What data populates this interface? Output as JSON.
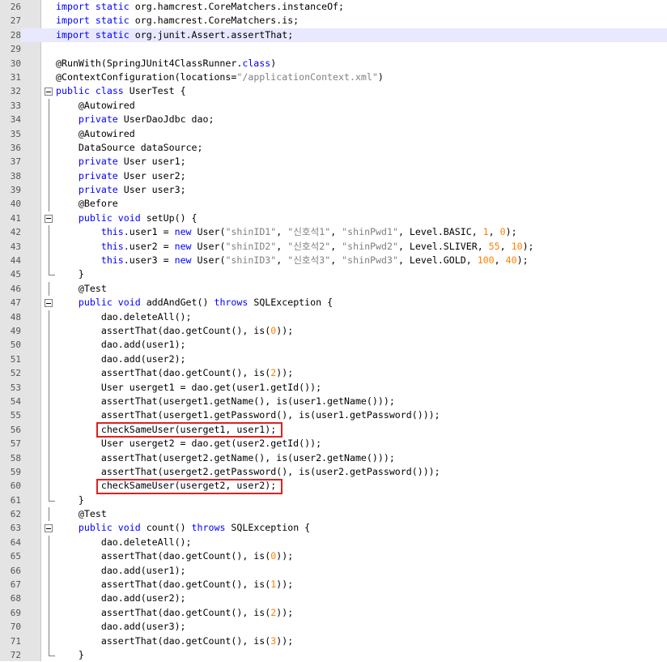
{
  "editor": {
    "current_line": 28,
    "highlighted_lines": [
      56,
      60
    ],
    "lines": [
      {
        "no": "26",
        "fold": "none",
        "tokens": [
          [
            "kw",
            "import"
          ],
          [
            "plain",
            " "
          ],
          [
            "kw",
            "static"
          ],
          [
            "plain",
            " org.hamcrest.CoreMatchers.instanceOf;"
          ]
        ]
      },
      {
        "no": "27",
        "fold": "none",
        "tokens": [
          [
            "kw",
            "import"
          ],
          [
            "plain",
            " "
          ],
          [
            "kw",
            "static"
          ],
          [
            "plain",
            " org.hamcrest.CoreMatchers.is;"
          ]
        ]
      },
      {
        "no": "28",
        "fold": "none",
        "tokens": [
          [
            "kw",
            "import"
          ],
          [
            "plain",
            " "
          ],
          [
            "kw",
            "static"
          ],
          [
            "plain",
            " org.junit.Assert.assertThat;"
          ]
        ]
      },
      {
        "no": "29",
        "fold": "none",
        "tokens": []
      },
      {
        "no": "30",
        "fold": "none",
        "tokens": [
          [
            "plain",
            "@RunWith(SpringJUnit4ClassRunner."
          ],
          [
            "kw",
            "class"
          ],
          [
            "plain",
            ")"
          ]
        ]
      },
      {
        "no": "31",
        "fold": "none",
        "tokens": [
          [
            "plain",
            "@ContextConfiguration(locations="
          ],
          [
            "str",
            "\"/applicationContext.xml\""
          ],
          [
            "plain",
            ")"
          ]
        ]
      },
      {
        "no": "32",
        "fold": "open",
        "tokens": [
          [
            "kw",
            "public"
          ],
          [
            "plain",
            " "
          ],
          [
            "kw",
            "class"
          ],
          [
            "plain",
            " UserTest {"
          ]
        ]
      },
      {
        "no": "33",
        "fold": "line",
        "tokens": [
          [
            "plain",
            "    @Autowired"
          ]
        ]
      },
      {
        "no": "34",
        "fold": "line",
        "tokens": [
          [
            "plain",
            "    "
          ],
          [
            "kw",
            "private"
          ],
          [
            "plain",
            " UserDaoJdbc dao;"
          ]
        ]
      },
      {
        "no": "35",
        "fold": "line",
        "tokens": [
          [
            "plain",
            "    @Autowired"
          ]
        ]
      },
      {
        "no": "36",
        "fold": "line",
        "tokens": [
          [
            "plain",
            "    DataSource dataSource;"
          ]
        ]
      },
      {
        "no": "37",
        "fold": "line",
        "tokens": [
          [
            "plain",
            "    "
          ],
          [
            "kw",
            "private"
          ],
          [
            "plain",
            " User user1;"
          ]
        ]
      },
      {
        "no": "38",
        "fold": "line",
        "tokens": [
          [
            "plain",
            "    "
          ],
          [
            "kw",
            "private"
          ],
          [
            "plain",
            " User user2;"
          ]
        ]
      },
      {
        "no": "39",
        "fold": "line",
        "tokens": [
          [
            "plain",
            "    "
          ],
          [
            "kw",
            "private"
          ],
          [
            "plain",
            " User user3;"
          ]
        ]
      },
      {
        "no": "40",
        "fold": "line",
        "tokens": [
          [
            "plain",
            "    @Before"
          ]
        ]
      },
      {
        "no": "41",
        "fold": "open",
        "tokens": [
          [
            "plain",
            "    "
          ],
          [
            "kw",
            "public"
          ],
          [
            "plain",
            " "
          ],
          [
            "kw",
            "void"
          ],
          [
            "plain",
            " setUp() {"
          ]
        ]
      },
      {
        "no": "42",
        "fold": "line",
        "tokens": [
          [
            "plain",
            "        "
          ],
          [
            "kw",
            "this"
          ],
          [
            "plain",
            ".user1 = "
          ],
          [
            "kw",
            "new"
          ],
          [
            "plain",
            " User("
          ],
          [
            "str",
            "\"shinID1\""
          ],
          [
            "plain",
            ", "
          ],
          [
            "str",
            "\"신호석1\""
          ],
          [
            "plain",
            ", "
          ],
          [
            "str",
            "\"shinPwd1\""
          ],
          [
            "plain",
            ", Level.BASIC, "
          ],
          [
            "num",
            "1"
          ],
          [
            "plain",
            ", "
          ],
          [
            "num",
            "0"
          ],
          [
            "plain",
            ");"
          ]
        ]
      },
      {
        "no": "43",
        "fold": "line",
        "tokens": [
          [
            "plain",
            "        "
          ],
          [
            "kw",
            "this"
          ],
          [
            "plain",
            ".user2 = "
          ],
          [
            "kw",
            "new"
          ],
          [
            "plain",
            " User("
          ],
          [
            "str",
            "\"shinID2\""
          ],
          [
            "plain",
            ", "
          ],
          [
            "str",
            "\"신호석2\""
          ],
          [
            "plain",
            ", "
          ],
          [
            "str",
            "\"shinPwd2\""
          ],
          [
            "plain",
            ", Level.SLIVER, "
          ],
          [
            "num",
            "55"
          ],
          [
            "plain",
            ", "
          ],
          [
            "num",
            "10"
          ],
          [
            "plain",
            ");"
          ]
        ]
      },
      {
        "no": "44",
        "fold": "line",
        "tokens": [
          [
            "plain",
            "        "
          ],
          [
            "kw",
            "this"
          ],
          [
            "plain",
            ".user3 = "
          ],
          [
            "kw",
            "new"
          ],
          [
            "plain",
            " User("
          ],
          [
            "str",
            "\"shinID3\""
          ],
          [
            "plain",
            ", "
          ],
          [
            "str",
            "\"신호석3\""
          ],
          [
            "plain",
            ", "
          ],
          [
            "str",
            "\"shinPwd3\""
          ],
          [
            "plain",
            ", Level.GOLD, "
          ],
          [
            "num",
            "100"
          ],
          [
            "plain",
            ", "
          ],
          [
            "num",
            "40"
          ],
          [
            "plain",
            ");"
          ]
        ]
      },
      {
        "no": "45",
        "fold": "close",
        "tokens": [
          [
            "plain",
            "    }"
          ]
        ]
      },
      {
        "no": "46",
        "fold": "line",
        "tokens": [
          [
            "plain",
            "    @Test"
          ]
        ]
      },
      {
        "no": "47",
        "fold": "open",
        "tokens": [
          [
            "plain",
            "    "
          ],
          [
            "kw",
            "public"
          ],
          [
            "plain",
            " "
          ],
          [
            "kw",
            "void"
          ],
          [
            "plain",
            " addAndGet() "
          ],
          [
            "kw",
            "throws"
          ],
          [
            "plain",
            " SQLException {"
          ]
        ]
      },
      {
        "no": "48",
        "fold": "line",
        "tokens": [
          [
            "plain",
            "        dao.deleteAll();"
          ]
        ]
      },
      {
        "no": "49",
        "fold": "line",
        "tokens": [
          [
            "plain",
            "        assertThat(dao.getCount(), is("
          ],
          [
            "num",
            "0"
          ],
          [
            "plain",
            "));"
          ]
        ]
      },
      {
        "no": "50",
        "fold": "line",
        "tokens": [
          [
            "plain",
            "        dao.add(user1);"
          ]
        ]
      },
      {
        "no": "51",
        "fold": "line",
        "tokens": [
          [
            "plain",
            "        dao.add(user2);"
          ]
        ]
      },
      {
        "no": "52",
        "fold": "line",
        "tokens": [
          [
            "plain",
            "        assertThat(dao.getCount(), is("
          ],
          [
            "num",
            "2"
          ],
          [
            "plain",
            "));"
          ]
        ]
      },
      {
        "no": "53",
        "fold": "line",
        "tokens": [
          [
            "plain",
            "        User userget1 = dao.get(user1.getId());"
          ]
        ]
      },
      {
        "no": "54",
        "fold": "line",
        "tokens": [
          [
            "plain",
            "        assertThat(userget1.getName(), is(user1.getName()));"
          ]
        ]
      },
      {
        "no": "55",
        "fold": "line",
        "tokens": [
          [
            "plain",
            "        assertThat(userget1.getPassword(), is(user1.getPassword()));"
          ]
        ]
      },
      {
        "no": "56",
        "fold": "line",
        "tokens": [
          [
            "plain",
            "        checkSameUser(userget1, user1);"
          ]
        ]
      },
      {
        "no": "57",
        "fold": "line",
        "tokens": [
          [
            "plain",
            "        User userget2 = dao.get(user2.getId());"
          ]
        ]
      },
      {
        "no": "58",
        "fold": "line",
        "tokens": [
          [
            "plain",
            "        assertThat(userget2.getName(), is(user2.getName()));"
          ]
        ]
      },
      {
        "no": "59",
        "fold": "line",
        "tokens": [
          [
            "plain",
            "        assertThat(userget2.getPassword(), is(user2.getPassword()));"
          ]
        ]
      },
      {
        "no": "60",
        "fold": "line",
        "tokens": [
          [
            "plain",
            "        checkSameUser(userget2, user2);"
          ]
        ]
      },
      {
        "no": "61",
        "fold": "close",
        "tokens": [
          [
            "plain",
            "    }"
          ]
        ]
      },
      {
        "no": "62",
        "fold": "line",
        "tokens": [
          [
            "plain",
            "    @Test"
          ]
        ]
      },
      {
        "no": "63",
        "fold": "open",
        "tokens": [
          [
            "plain",
            "    "
          ],
          [
            "kw",
            "public"
          ],
          [
            "plain",
            " "
          ],
          [
            "kw",
            "void"
          ],
          [
            "plain",
            " count() "
          ],
          [
            "kw",
            "throws"
          ],
          [
            "plain",
            " SQLException {"
          ]
        ]
      },
      {
        "no": "64",
        "fold": "line",
        "tokens": [
          [
            "plain",
            "        dao.deleteAll();"
          ]
        ]
      },
      {
        "no": "65",
        "fold": "line",
        "tokens": [
          [
            "plain",
            "        assertThat(dao.getCount(), is("
          ],
          [
            "num",
            "0"
          ],
          [
            "plain",
            "));"
          ]
        ]
      },
      {
        "no": "66",
        "fold": "line",
        "tokens": [
          [
            "plain",
            "        dao.add(user1);"
          ]
        ]
      },
      {
        "no": "67",
        "fold": "line",
        "tokens": [
          [
            "plain",
            "        assertThat(dao.getCount(), is("
          ],
          [
            "num",
            "1"
          ],
          [
            "plain",
            "));"
          ]
        ]
      },
      {
        "no": "68",
        "fold": "line",
        "tokens": [
          [
            "plain",
            "        dao.add(user2);"
          ]
        ]
      },
      {
        "no": "69",
        "fold": "line",
        "tokens": [
          [
            "plain",
            "        assertThat(dao.getCount(), is("
          ],
          [
            "num",
            "2"
          ],
          [
            "plain",
            "));"
          ]
        ]
      },
      {
        "no": "70",
        "fold": "line",
        "tokens": [
          [
            "plain",
            "        dao.add(user3);"
          ]
        ]
      },
      {
        "no": "71",
        "fold": "line",
        "tokens": [
          [
            "plain",
            "        assertThat(dao.getCount(), is("
          ],
          [
            "num",
            "3"
          ],
          [
            "plain",
            "));"
          ]
        ]
      },
      {
        "no": "72",
        "fold": "close",
        "tokens": [
          [
            "plain",
            "    }"
          ]
        ]
      }
    ]
  },
  "colors": {
    "keyword": "#0000ff",
    "string": "#808080",
    "number": "#ff8000",
    "highlight_box": "#e02020",
    "current_line_bg": "#e8e8ff"
  }
}
